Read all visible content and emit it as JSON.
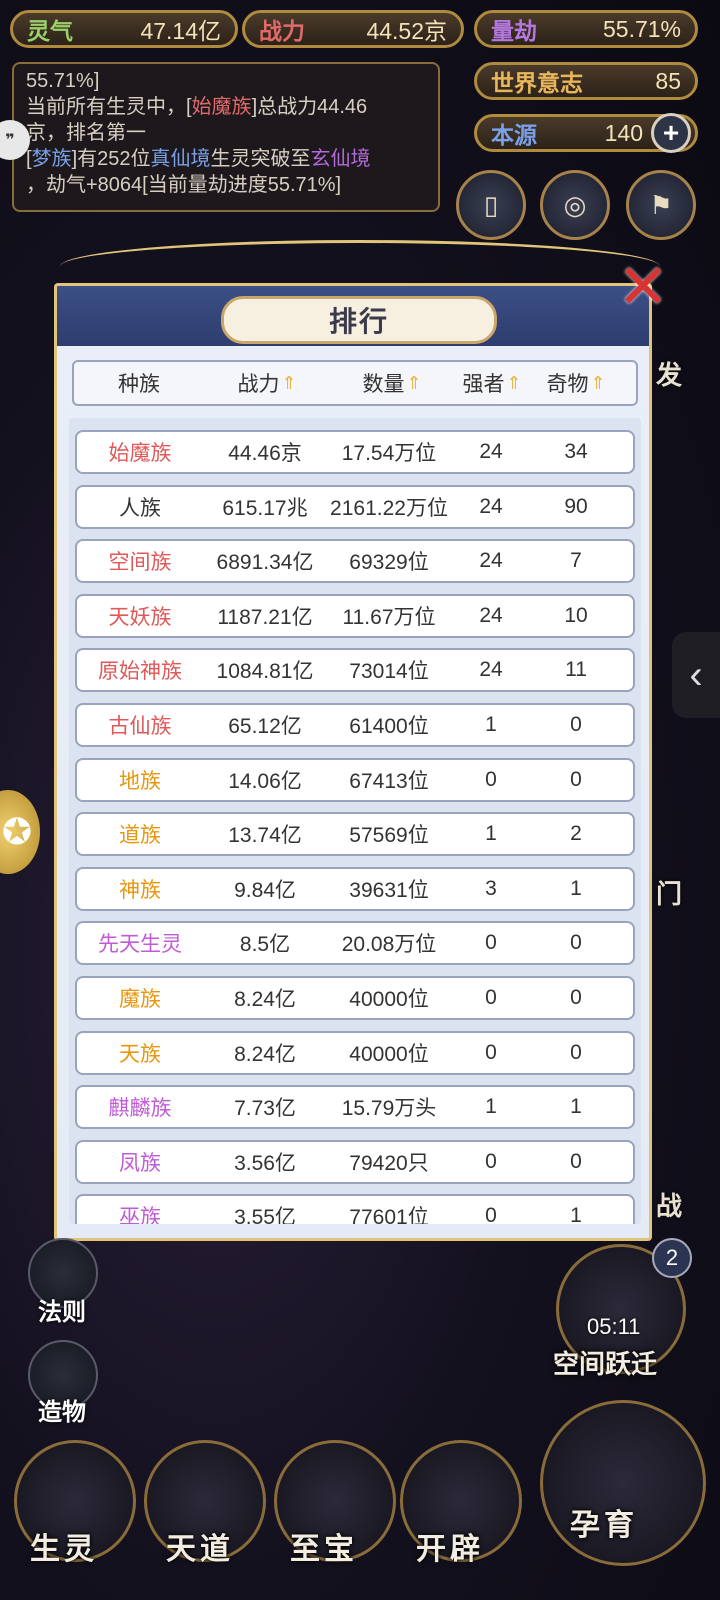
{
  "top_stats": {
    "lingqi": {
      "label": "灵气",
      "value": "47.14亿"
    },
    "zhanli": {
      "label": "战力",
      "value": "44.52京"
    },
    "liangjie": {
      "label": "量劫",
      "value": "55.71%"
    },
    "shijie": {
      "label": "世界意志",
      "value": "85"
    },
    "benyuan": {
      "label": "本源",
      "value": "140"
    }
  },
  "log": {
    "line1": "55.71%]",
    "line2_pre": "当前所有生灵中，[",
    "line2_race": "始魔族",
    "line2_post": "]总战力44.46",
    "line3": "京，排名第一",
    "line4_pre": "[",
    "line4_race": "梦族",
    "line4_mid": "]有252位",
    "line4_realm1": "真仙境",
    "line4_mid2": "生灵突破至",
    "line4_realm2": "玄仙境",
    "line5": "，劫气+8064[当前量劫进度55.71%]"
  },
  "panel": {
    "title": "排行",
    "headers": {
      "race": "种族",
      "power": "战力",
      "count": "数量",
      "strong": "强者",
      "treasure": "奇物"
    },
    "rows": [
      {
        "race": "始魔族",
        "power": "44.46京",
        "count": "17.54万位",
        "strong": "24",
        "treasure": "34",
        "color": "#e05858"
      },
      {
        "race": "人族",
        "power": "615.17兆",
        "count": "2161.22万位",
        "strong": "24",
        "treasure": "90",
        "color": "#333333"
      },
      {
        "race": "空间族",
        "power": "6891.34亿",
        "count": "69329位",
        "strong": "24",
        "treasure": "7",
        "color": "#e05858"
      },
      {
        "race": "天妖族",
        "power": "1187.21亿",
        "count": "11.67万位",
        "strong": "24",
        "treasure": "10",
        "color": "#e05858"
      },
      {
        "race": "原始神族",
        "power": "1084.81亿",
        "count": "73014位",
        "strong": "24",
        "treasure": "11",
        "color": "#e05858"
      },
      {
        "race": "古仙族",
        "power": "65.12亿",
        "count": "61400位",
        "strong": "1",
        "treasure": "0",
        "color": "#e05858"
      },
      {
        "race": "地族",
        "power": "14.06亿",
        "count": "67413位",
        "strong": "0",
        "treasure": "0",
        "color": "#e8960e"
      },
      {
        "race": "道族",
        "power": "13.74亿",
        "count": "57569位",
        "strong": "1",
        "treasure": "2",
        "color": "#e8960e"
      },
      {
        "race": "神族",
        "power": "9.84亿",
        "count": "39631位",
        "strong": "3",
        "treasure": "1",
        "color": "#e8960e"
      },
      {
        "race": "先天生灵",
        "power": "8.5亿",
        "count": "20.08万位",
        "strong": "0",
        "treasure": "0",
        "color": "#c05ad6"
      },
      {
        "race": "魔族",
        "power": "8.24亿",
        "count": "40000位",
        "strong": "0",
        "treasure": "0",
        "color": "#e8960e"
      },
      {
        "race": "天族",
        "power": "8.24亿",
        "count": "40000位",
        "strong": "0",
        "treasure": "0",
        "color": "#e8960e"
      },
      {
        "race": "麒麟族",
        "power": "7.73亿",
        "count": "15.79万头",
        "strong": "1",
        "treasure": "1",
        "color": "#c05ad6"
      },
      {
        "race": "凤族",
        "power": "3.56亿",
        "count": "79420只",
        "strong": "0",
        "treasure": "0",
        "color": "#c05ad6"
      },
      {
        "race": "巫族",
        "power": "3.55亿",
        "count": "77601位",
        "strong": "0",
        "treasure": "1",
        "color": "#c05ad6"
      }
    ]
  },
  "side_labels": {
    "fa": "发",
    "men": "门",
    "zhan": "战"
  },
  "left_buttons": {
    "faze": "法则",
    "zaowu": "造物"
  },
  "bottom_nav": {
    "shengling": "生灵",
    "tiandao": "天道",
    "zhibao": "至宝",
    "kaipi": "开辟",
    "yunyu": "孕育"
  },
  "space_jump": {
    "label": "空间跃迁",
    "timer": "05:11",
    "badge": "2"
  }
}
